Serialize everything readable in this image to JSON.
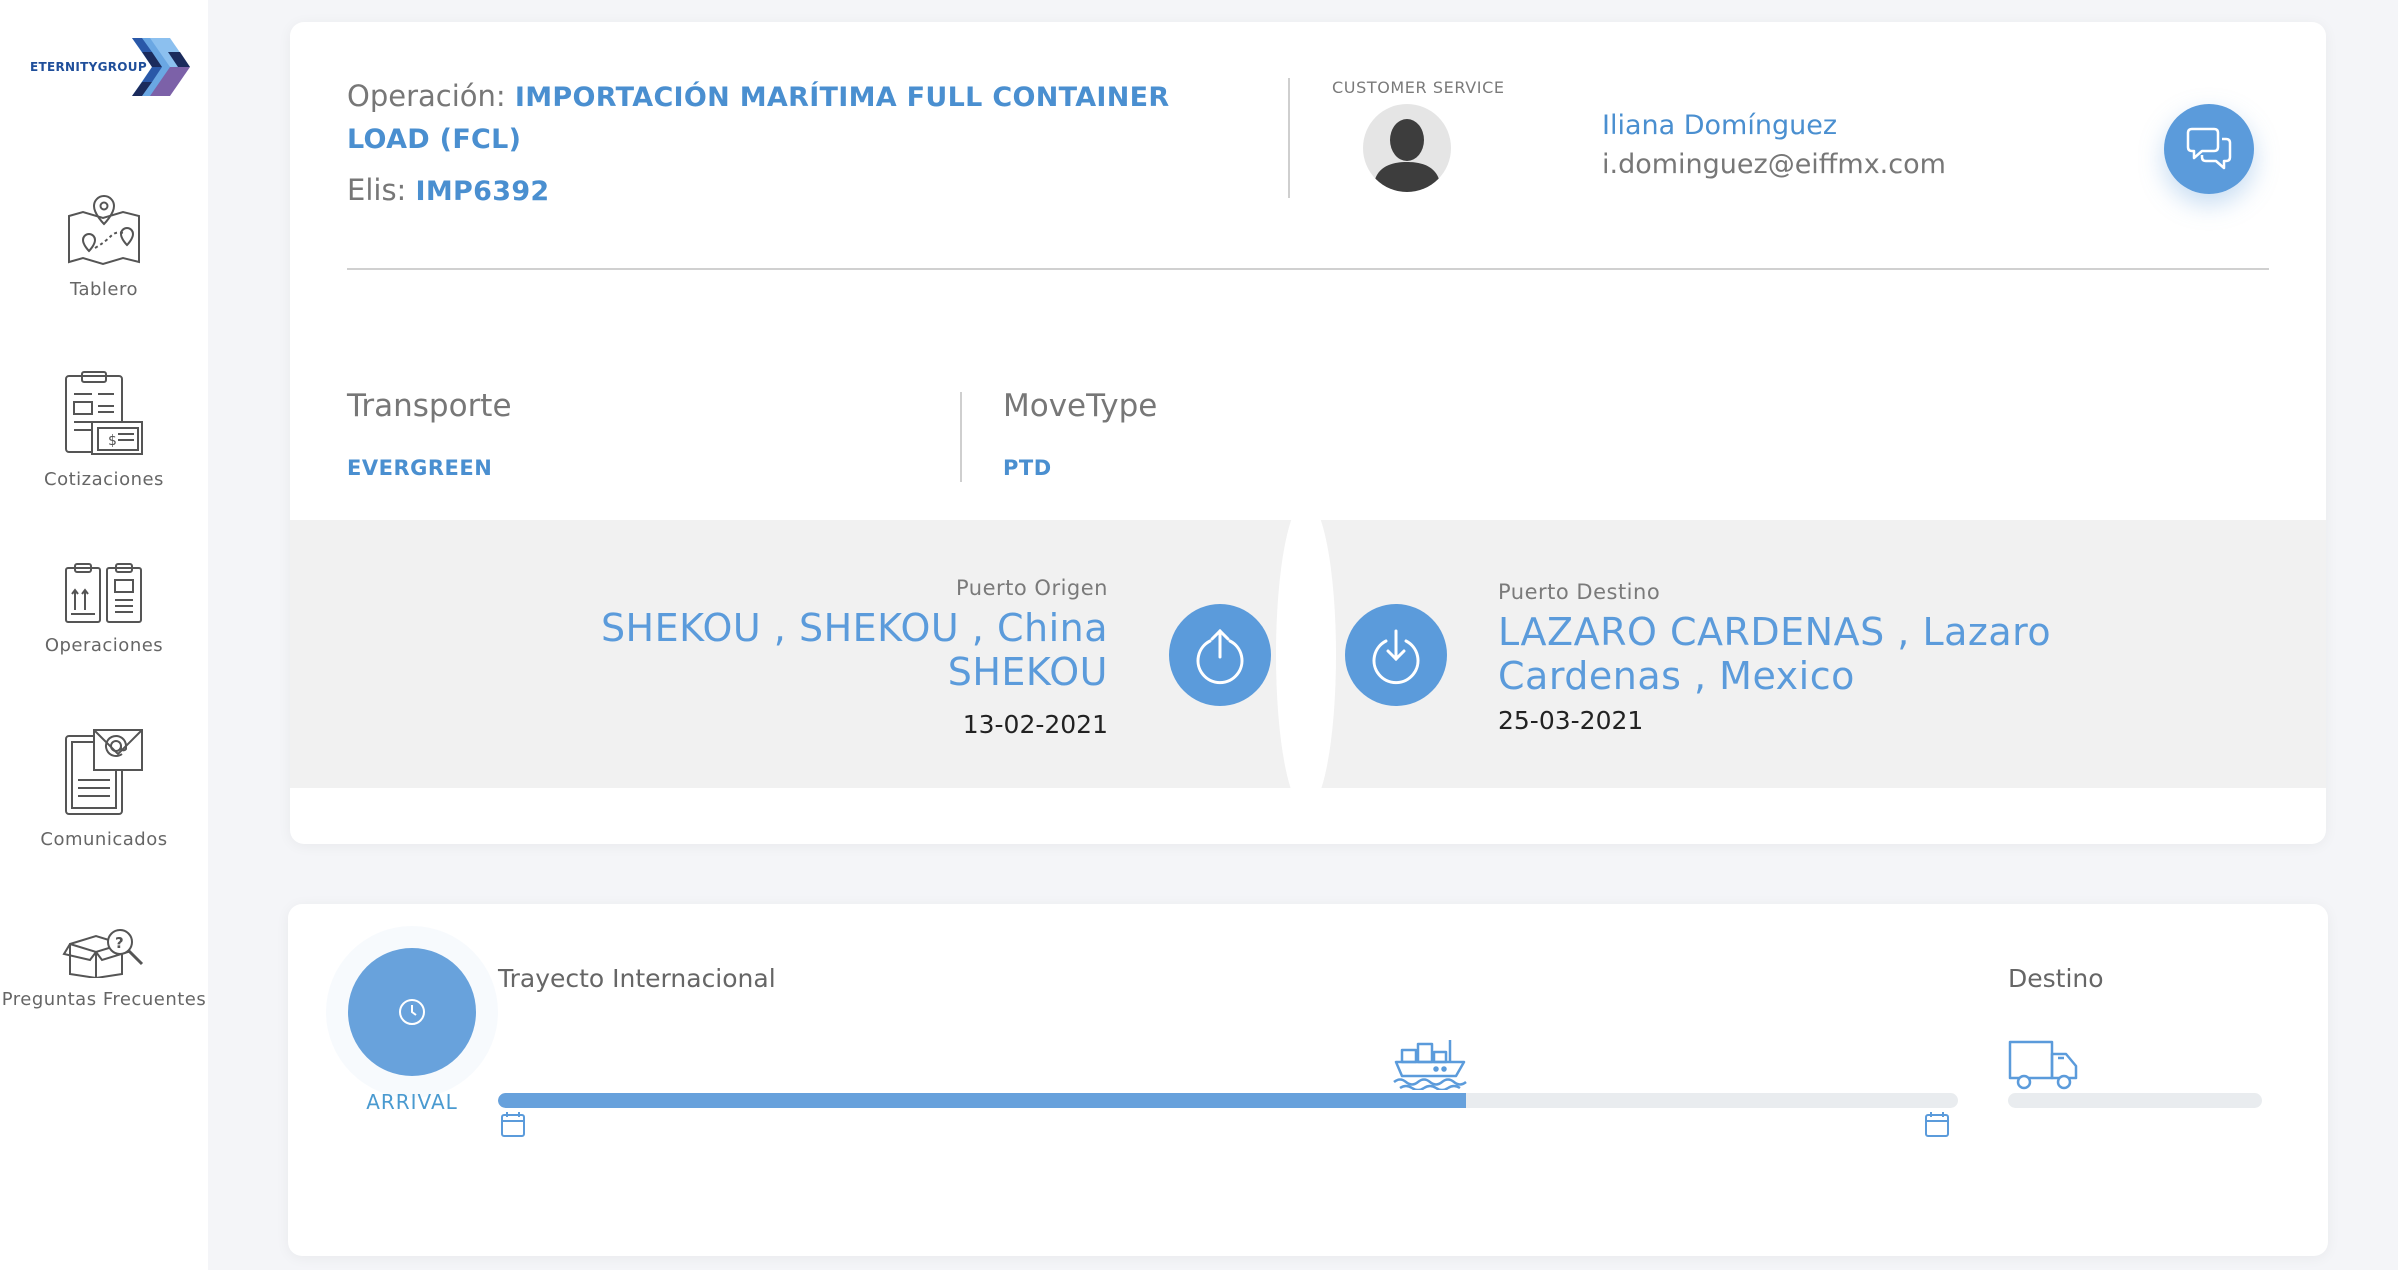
{
  "brand": {
    "logo_text": "ETERNITYGROUP"
  },
  "sidebar": {
    "items": [
      {
        "label": "Tablero",
        "icon": "map-pins-icon"
      },
      {
        "label": "Cotizaciones",
        "icon": "quotation-icon"
      },
      {
        "label": "Operaciones",
        "icon": "clipboards-icon"
      },
      {
        "label": "Comunicados",
        "icon": "mail-document-icon"
      },
      {
        "label": "Preguntas Frecuentes",
        "icon": "faq-box-icon"
      }
    ]
  },
  "operation": {
    "op_label": "Operación:",
    "op_value": "IMPORTACIÓN MARÍTIMA FULL CONTAINER LOAD (FCL)",
    "elis_label": "Elis:",
    "elis_value": "IMP6392"
  },
  "customer_service": {
    "label": "CUSTOMER SERVICE",
    "name": "Iliana Domínguez",
    "email": "i.dominguez@eiffmx.com"
  },
  "transport": {
    "title": "Transporte",
    "value": "EVERGREEN"
  },
  "movetype": {
    "title": "MoveType",
    "value": "PTD"
  },
  "origin": {
    "label": "Puerto Origen",
    "line1": "SHEKOU , SHEKOU , China",
    "line2": "SHEKOU",
    "date": "13-02-2021"
  },
  "destination": {
    "label": "Puerto Destino",
    "line1": "LAZARO CARDENAS , Lazaro",
    "line2": "Cardenas , Mexico",
    "date": "25-03-2021"
  },
  "tracking": {
    "status": "ARRIVAL",
    "international_title": "Trayecto Internacional",
    "international_progress": 0.663,
    "destination_title": "Destino",
    "destination_progress": 0
  },
  "colors": {
    "accent": "#5b9bdb",
    "text_blue": "#4a8fd0",
    "band": "#f1f1f1"
  }
}
